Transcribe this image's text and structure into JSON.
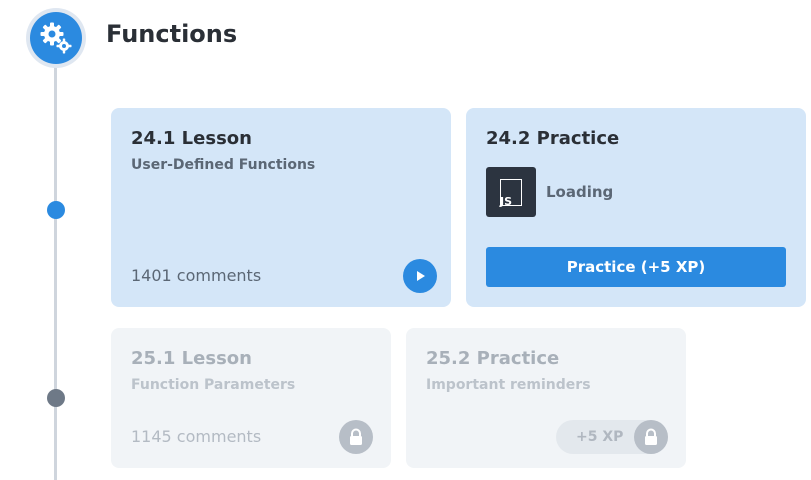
{
  "section": {
    "title": "Functions",
    "icon": "gears-icon",
    "accent": "#2b8ae0"
  },
  "cards": {
    "lesson_24": {
      "title": "24.1 Lesson",
      "subtitle": "User-Defined Functions",
      "comments": "1401 comments",
      "action_icon": "play-icon",
      "state": "unlocked"
    },
    "practice_24": {
      "title": "24.2 Practice",
      "language_icon": "JS",
      "status": "Loading",
      "button_label": "Practice (+5 XP)",
      "state": "unlocked"
    },
    "lesson_25": {
      "title": "25.1 Lesson",
      "subtitle": "Function Parameters",
      "comments": "1145 comments",
      "action_icon": "lock-icon",
      "state": "locked"
    },
    "practice_25": {
      "title": "25.2 Practice",
      "subtitle": "Important reminders",
      "xp_label": "+5 XP",
      "action_icon": "lock-icon",
      "state": "locked"
    }
  },
  "colors": {
    "active_card": "#d4e6f8",
    "locked_card": "#f1f4f7",
    "timeline_active": "#2b8ae0",
    "timeline_locked": "#6e7987"
  }
}
